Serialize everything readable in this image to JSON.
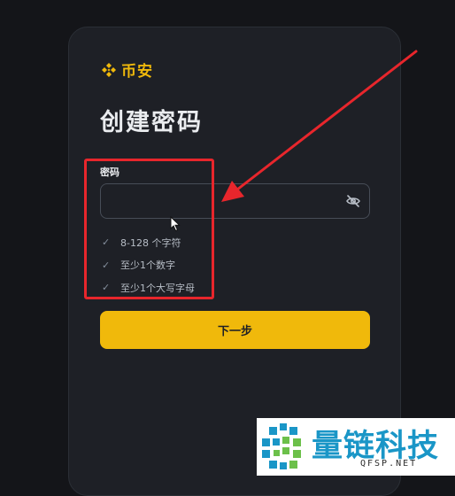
{
  "brand": {
    "name": "币安",
    "logo_icon": "binance-diamond-logo",
    "color": "#f0b90b"
  },
  "page": {
    "title": "创建密码"
  },
  "password_field": {
    "label": "密码",
    "value": "",
    "placeholder": "",
    "toggle_icon": "eye-slash-icon"
  },
  "rules": [
    {
      "icon": "check-icon",
      "text": "8-128 个字符"
    },
    {
      "icon": "check-icon",
      "text": "至少1个数字"
    },
    {
      "icon": "check-icon",
      "text": "至少1个大写字母"
    }
  ],
  "next_button": {
    "label": "下一步",
    "color": "#fcd535"
  },
  "annotation": {
    "color": "#e8262c"
  },
  "watermark": {
    "title": "量链科技",
    "domain": "QFSP.NET",
    "logo_icon": "qfsp-pixel-logo",
    "color": "#1a96c7"
  }
}
